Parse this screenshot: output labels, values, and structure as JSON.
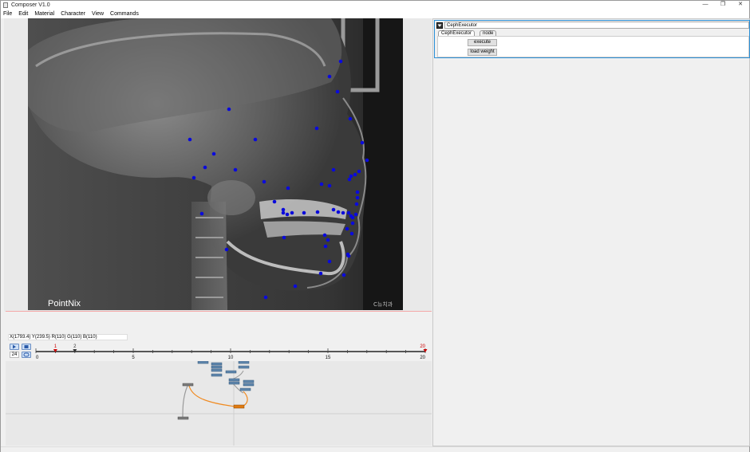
{
  "window": {
    "title": "Composer V1.0",
    "controls": [
      "—",
      "❐",
      "✕"
    ]
  },
  "menu": [
    "File",
    "Edit",
    "Material",
    "Character",
    "View",
    "Commands"
  ],
  "viewport": {
    "watermark_left": "PointNix",
    "watermark_right": "C뉴치과"
  },
  "status": {
    "readout": "X(1793.4) Y(239.5) R(110) G(110) B(110)"
  },
  "timeline": {
    "frame_count": "24",
    "start": 0,
    "end": 20,
    "major_ticks": [
      0,
      5,
      10,
      15,
      20
    ],
    "markers": [
      {
        "label": "1",
        "frame": 1,
        "color": "#cc0000"
      },
      {
        "label": "2",
        "frame": 2,
        "color": "#333333"
      },
      {
        "label": "20",
        "frame": 20,
        "color": "#cc0000"
      }
    ],
    "icons": [
      "play-icon",
      "stop-icon",
      "loop-icon"
    ]
  },
  "panel": {
    "header": "CephExecutor",
    "tabs": [
      "CephExecutor",
      "node"
    ],
    "active_tab": "CephExecutor",
    "buttons": {
      "execute": "execute",
      "load_weight": "load weight"
    }
  },
  "colors": {
    "landmark": "#0a0adc",
    "selected_node": "#e07a10",
    "edge_orange": "#f08a20",
    "accent": "#2b8fd6"
  }
}
